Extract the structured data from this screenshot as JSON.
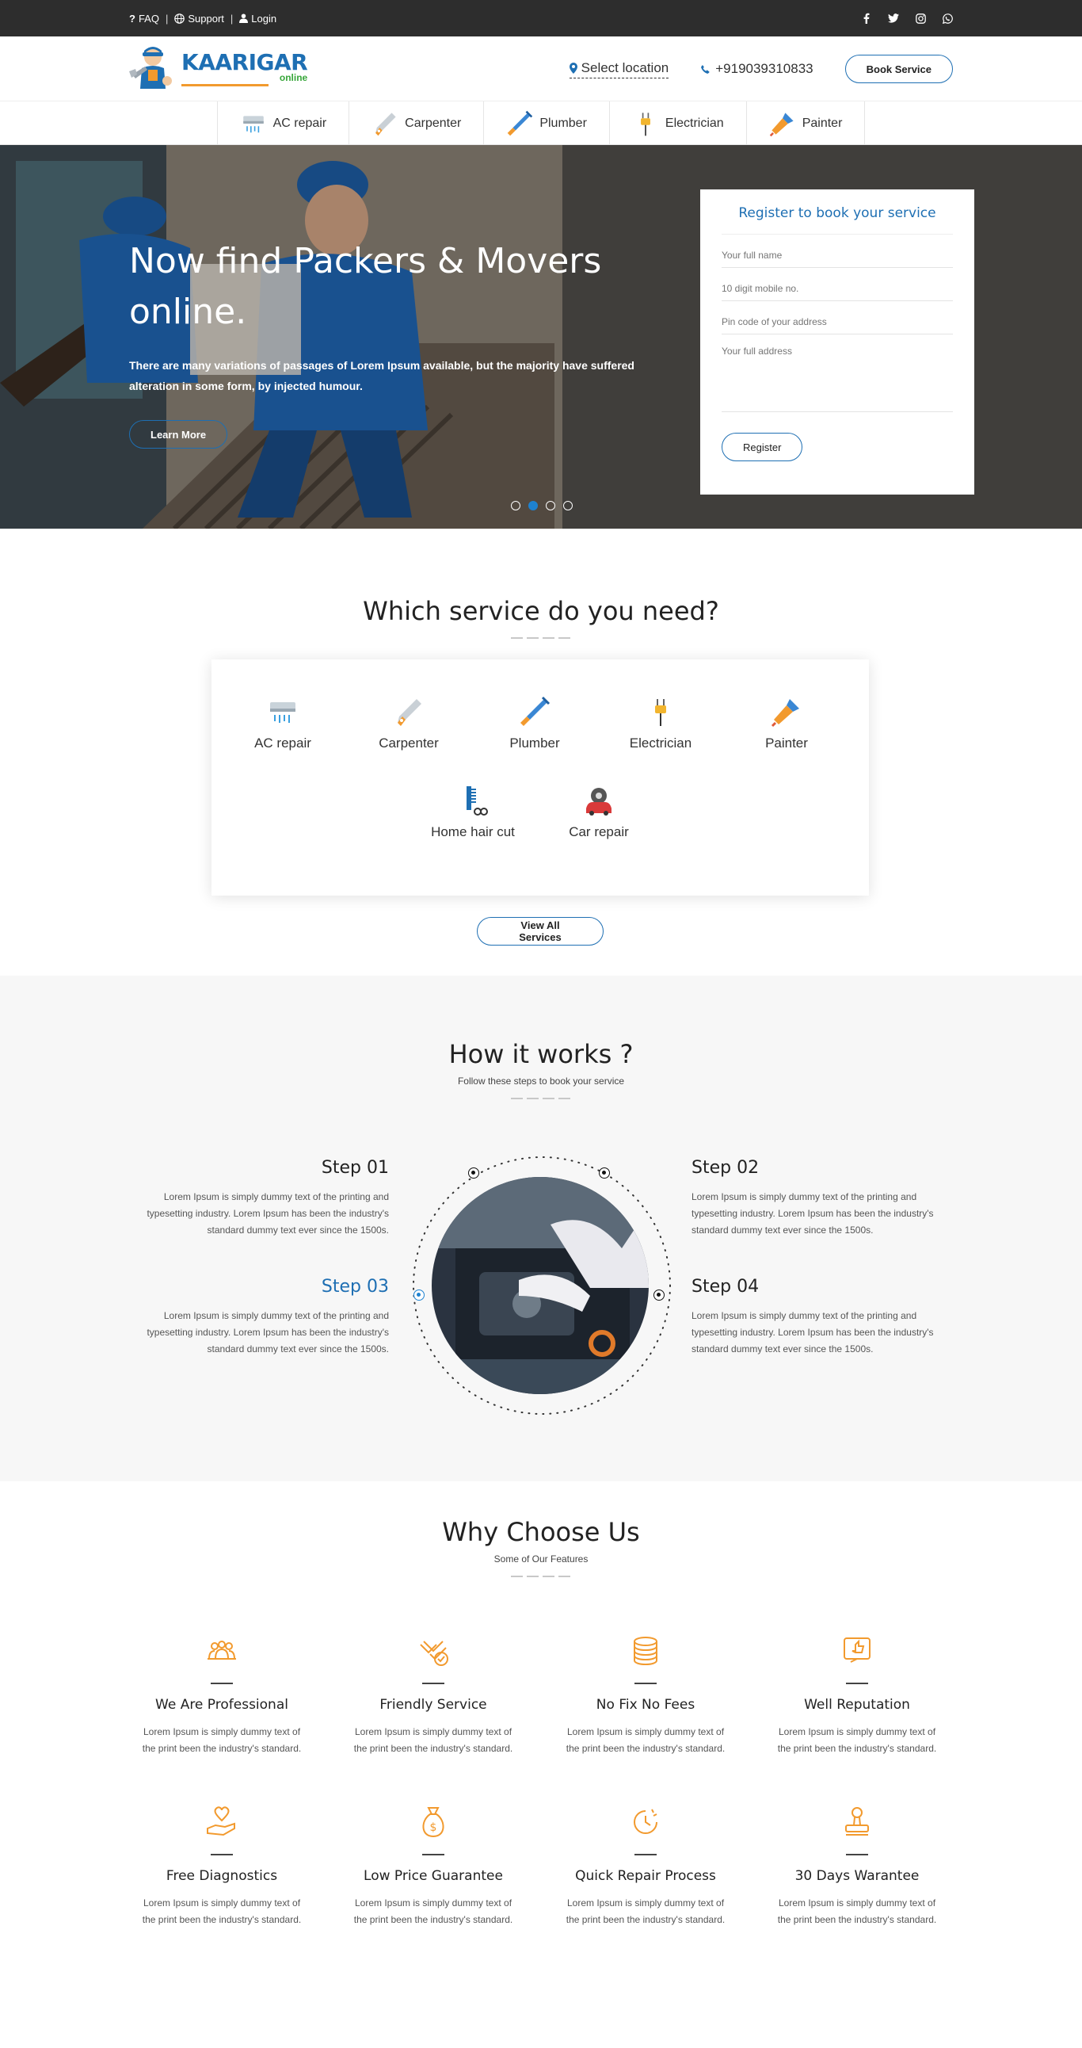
{
  "topbar": {
    "faq": "FAQ",
    "support": "Support",
    "login": "Login",
    "social": [
      "facebook-icon",
      "twitter-icon",
      "instagram-icon",
      "whatsapp-icon"
    ]
  },
  "header": {
    "logo_text": "KAARIGAR",
    "logo_sub": "online",
    "location": "Select location",
    "phone": "+919039310833",
    "book_button": "Book Service"
  },
  "catnav": [
    {
      "label": "AC repair",
      "icon": "ac-icon"
    },
    {
      "label": "Carpenter",
      "icon": "saw-icon"
    },
    {
      "label": "Plumber",
      "icon": "wrench-icon"
    },
    {
      "label": "Electrician",
      "icon": "plug-icon"
    },
    {
      "label": "Painter",
      "icon": "paint-brush-icon"
    }
  ],
  "hero": {
    "title": "Now find Packers & Movers online.",
    "text": "There are many variations of passages of Lorem Ipsum available, but the majority have suffered alteration in some form, by injected humour.",
    "button": "Learn More",
    "slides": 4,
    "active_slide": 2
  },
  "register": {
    "title": "Register to book your service",
    "name_placeholder": "Your full name",
    "mobile_placeholder": "10 digit mobile no.",
    "pin_placeholder": "Pin code of your address",
    "address_placeholder": "Your full address",
    "button": "Register"
  },
  "services": {
    "title": "Which service do you need?",
    "items": [
      {
        "label": "AC repair",
        "icon": "ac-icon"
      },
      {
        "label": "Carpenter",
        "icon": "saw-icon"
      },
      {
        "label": "Plumber",
        "icon": "wrench-icon"
      },
      {
        "label": "Electrician",
        "icon": "plug-icon"
      },
      {
        "label": "Painter",
        "icon": "paint-brush-icon"
      },
      {
        "label": "Home hair cut",
        "icon": "comb-icon"
      },
      {
        "label": "Car repair",
        "icon": "car-icon"
      }
    ],
    "view_all": "View All Services"
  },
  "how": {
    "title": "How it works ?",
    "subtitle": "Follow these steps to book your service",
    "steps": [
      {
        "title": "Step 01",
        "text": "Lorem Ipsum is simply dummy text of the printing and typesetting industry. Lorem Ipsum has been the industry's standard dummy text ever since the 1500s."
      },
      {
        "title": "Step 02",
        "text": "Lorem Ipsum is simply dummy text of the printing and typesetting industry. Lorem Ipsum has been the industry's standard dummy text ever since the 1500s."
      },
      {
        "title": "Step 03",
        "text": "Lorem Ipsum is simply dummy text of the printing and typesetting industry. Lorem Ipsum has been the industry's standard dummy text ever since the 1500s."
      },
      {
        "title": "Step 04",
        "text": "Lorem Ipsum is simply dummy text of the printing and typesetting industry. Lorem Ipsum has been the industry's standard dummy text ever since the 1500s."
      }
    ],
    "active_step": 3
  },
  "why": {
    "title": "Why Choose Us",
    "subtitle": "Some of Our Features",
    "features": [
      {
        "title": "We Are Professional",
        "text": "Lorem Ipsum is simply dummy text of the print been the industry's standard.",
        "icon": "team-icon"
      },
      {
        "title": "Friendly Service",
        "text": "Lorem Ipsum is simply dummy text of the print been the industry's standard.",
        "icon": "handshake-icon"
      },
      {
        "title": "No Fix No Fees",
        "text": "Lorem Ipsum is simply dummy text of the print been the industry's standard.",
        "icon": "coins-icon"
      },
      {
        "title": "Well Reputation",
        "text": "Lorem Ipsum is simply dummy text of the print been the industry's standard.",
        "icon": "thumbs-up-icon"
      },
      {
        "title": "Free Diagnostics",
        "text": "Lorem Ipsum is simply dummy text of the print been the industry's standard.",
        "icon": "heart-hand-icon"
      },
      {
        "title": "Low Price Guarantee",
        "text": "Lorem Ipsum is simply dummy text of the print been the industry's standard.",
        "icon": "money-bag-icon"
      },
      {
        "title": "Quick Repair Process",
        "text": "Lorem Ipsum is simply dummy text of the print been the industry's standard.",
        "icon": "clock-icon"
      },
      {
        "title": "30 Days Warantee",
        "text": "Lorem Ipsum is simply dummy text of the print been the industry's standard.",
        "icon": "stamp-icon"
      }
    ]
  },
  "colors": {
    "brand_blue": "#1e6fb3",
    "accent_orange": "#f29a2e",
    "topbar_bg": "#2d2d2d",
    "section_gray": "#f7f7f7"
  }
}
